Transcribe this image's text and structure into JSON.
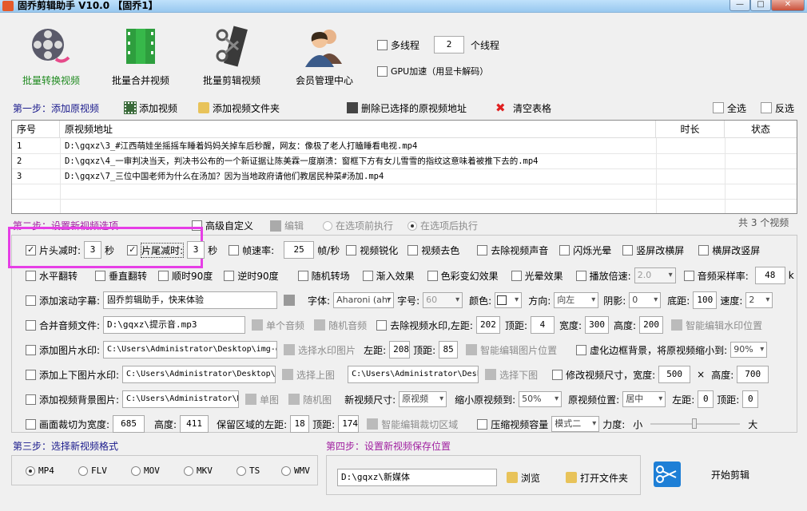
{
  "window": {
    "title": "固乔剪辑助手 V10.0  【固乔1】",
    "min": "—",
    "max": "□",
    "close": "✕"
  },
  "toolbar": {
    "convert": "批量转换视频",
    "merge": "批量合并视频",
    "clip": "批量剪辑视频",
    "member": "会员管理中心",
    "multithread_label": "多线程",
    "thread_count": "2",
    "thread_unit": "个线程",
    "gpu_label": "GPU加速（用显卡解码）"
  },
  "step1": {
    "title": "第一步：添加原视频",
    "add_video": "添加视频",
    "add_folder": "添加视频文件夹",
    "delete_selected": "删除已选择的原视频地址",
    "clear_table": "清空表格",
    "select_all": "全选",
    "invert": "反选"
  },
  "table": {
    "headers": [
      "序号",
      "原视频地址",
      "时长",
      "状态"
    ],
    "rows": [
      {
        "no": "1",
        "path": "D:\\gqxz\\3_#江西萌娃坐摇摇车睡着妈妈关掉车后秒醒，网友：像极了老人打瞌睡看电视.mp4"
      },
      {
        "no": "2",
        "path": "D:\\gqxz\\4_一审判决当天，判决书公布的一个新证据让陈美霖一度崩溃：窗框下方有女儿雪雪的指纹这意味着被推下去的.mp4"
      },
      {
        "no": "3",
        "path": "D:\\gqxz\\7_三位中国老师为什么在汤加？因为当地政府请他们教居民种菜#汤加.mp4"
      }
    ]
  },
  "step2": {
    "title": "第二步：设置新视频选项",
    "advanced": "高级自定义",
    "edit": "编辑",
    "before": "在选项前执行",
    "after": "在选项后执行",
    "count": "共 3 个视频"
  },
  "opt": {
    "head_cut": "片头减时:",
    "head_val": "3",
    "sec": "秒",
    "tail_cut": "片尾减时:",
    "tail_val": "3",
    "fps": "帧速率:",
    "fps_val": "25",
    "fps_unit": "帧/秒",
    "sharpen": "视频锐化",
    "decolor": "视频去色",
    "mute": "去除视频声音",
    "flash": "闪烁光晕",
    "v2h": "竖屏改横屏",
    "h2v": "横屏改竖屏",
    "hflip": "水平翻转",
    "vflip": "垂直翻转",
    "rot90": "顺时90度",
    "rot90ccw": "逆时90度",
    "random_trans": "随机转场",
    "fade_in": "渐入效果",
    "color_fx": "色彩变幻效果",
    "light_fx": "光晕效果",
    "speed": "播放倍速:",
    "speed_val": "2.0",
    "sample": "音频采样率:",
    "sample_val": "48",
    "sample_unit": "k",
    "scroll": "添加滚动字幕:",
    "scroll_text": "固乔剪辑助手，快来体验",
    "font": "字体:",
    "font_val": "Aharoni (ahr",
    "size": "字号:",
    "size_val": "60",
    "color": "颜色:",
    "dir": "方向:",
    "dir_val": "向左",
    "shadow": "阴影:",
    "shadow_val": "0",
    "bottom": "底距:",
    "bottom_val": "100",
    "speed2": "速度:",
    "speed2_val": "2",
    "merge_audio": "合并音频文件:",
    "audio_path": "D:\\gqxz\\提示音.mp3",
    "single_audio": "单个音频",
    "random_audio": "随机音频",
    "remove_wm": "去除视频水印,左距:",
    "wm_left": "202",
    "top": "顶距:",
    "wm_top": "4",
    "width": "宽度:",
    "wm_w": "300",
    "height": "高度:",
    "wm_h": "200",
    "smart_wm": "智能编辑水印位置",
    "img_wm": "添加图片水印:",
    "img_wm_path": "C:\\Users\\Administrator\\Desktop\\img-q",
    "pick_wm": "选择水印图片",
    "left": "左距:",
    "img_left": "208",
    "img_top": "85",
    "smart_img": "智能编辑图片位置",
    "blur_bg": "虚化边框背景，将原视频缩小到:",
    "blur_val": "90%",
    "tb_img": "添加上下图片水印:",
    "tb_path1": "C:\\Users\\Administrator\\Desktop\\i",
    "pick_top": "选择上图",
    "tb_path2": "C:\\Users\\Administrator\\Desk",
    "pick_bottom": "选择下图",
    "resize": "修改视频尺寸，宽度:",
    "resize_w": "500",
    "times": "×",
    "height2": "高度:",
    "resize_h": "700",
    "bg_img": "添加视频背景图片:",
    "bg_path": "C:\\Users\\Administrator\\D",
    "single_img": "单图",
    "random_img": "随机图",
    "new_size": "新视频尺寸:",
    "new_size_val": "原视频",
    "shrink": "缩小原视频到:",
    "shrink_val": "50%",
    "pos": "原视频位置:",
    "pos_val": "居中",
    "bg_left": "0",
    "bg_top": "0",
    "crop": "画面裁切为宽度:",
    "crop_w": "685",
    "crop_h_label": "高度:",
    "crop_h": "411",
    "keep_left": "保留区域的左距:",
    "crop_left": "18",
    "crop_top": "174",
    "smart_crop": "智能编辑裁切区域",
    "compress": "压缩视频容量",
    "mode_val": "模式二",
    "strength": "力度:",
    "small": "小",
    "big": "大"
  },
  "step3": {
    "title": "第三步：选择新视频格式",
    "formats": [
      "MP4",
      "FLV",
      "MOV",
      "MKV",
      "TS",
      "WMV"
    ]
  },
  "step4": {
    "title": "第四步：设置新视频保存位置",
    "path": "D:\\gqxz\\新媒体",
    "browse": "浏览",
    "open_folder": "打开文件夹",
    "start": "开始剪辑"
  },
  "colors": {
    "accent_green": "#1f8a1f",
    "step_blue": "#1a1a8c",
    "step_purple": "#a020a0",
    "highlight": "#e63ee6"
  }
}
